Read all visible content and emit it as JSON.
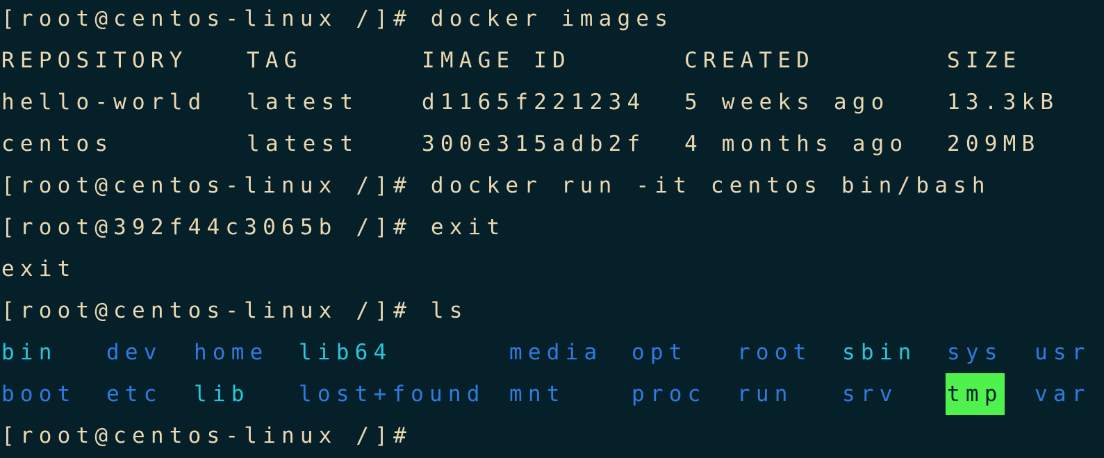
{
  "prompt": "[root@centos-linux /]# ",
  "commands": {
    "images": "docker images",
    "run": "docker run -it centos bin/bash",
    "exit": "exit",
    "ls": "ls"
  },
  "container_prompt": "[root@392f44c3065b /]# ",
  "exit_output": "exit",
  "images_table": {
    "headers": [
      "REPOSITORY",
      "TAG",
      "IMAGE ID",
      "CREATED",
      "SIZE"
    ],
    "rows": [
      [
        "hello-world",
        "latest",
        "d1165f221234",
        "5 weeks ago",
        "13.3kB"
      ],
      [
        "centos",
        "latest",
        "300e315adb2f",
        "4 months ago",
        "209MB"
      ]
    ]
  },
  "ls_output": {
    "row1": [
      "bin",
      "dev",
      "home",
      "lib64",
      "media",
      "opt",
      "root",
      "sbin",
      "sys",
      "usr"
    ],
    "row2": [
      "boot",
      "etc",
      "lib",
      "lost+found",
      "mnt",
      "proc",
      "run",
      "srv",
      "tmp",
      "var"
    ]
  },
  "colors": {
    "background": "#062029",
    "text": "#ead8b3",
    "directory": "#2f7be0",
    "symlink": "#29c6dd",
    "sticky_dir_bg": "#4ff24c"
  }
}
